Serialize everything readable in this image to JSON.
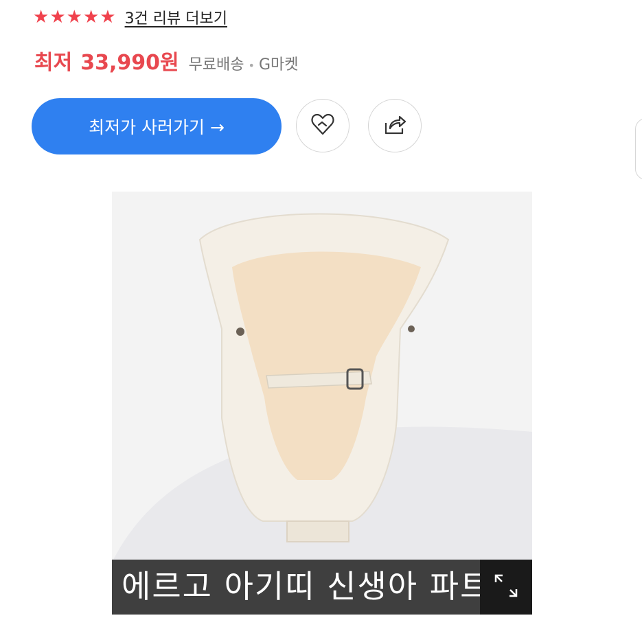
{
  "rating": {
    "stars": [
      "★",
      "★",
      "★",
      "★",
      "★"
    ],
    "value": 5,
    "max": 5,
    "color": "#f0424d",
    "review_link": "3건 리뷰 더보기"
  },
  "price": {
    "label": "최저",
    "value": "33,990원",
    "shipping": "무료배송",
    "separator": "•",
    "store": "G마켓",
    "color": "#e8484f"
  },
  "actions": {
    "buy_label": "최저가 사러가기 →",
    "buy_color": "#2f80f0",
    "like_icon": "heart-icon",
    "share_icon": "share-icon"
  },
  "product_image": {
    "caption": "에르고 아기띠 신생아 파트",
    "expand_icon": "expand-icon"
  }
}
